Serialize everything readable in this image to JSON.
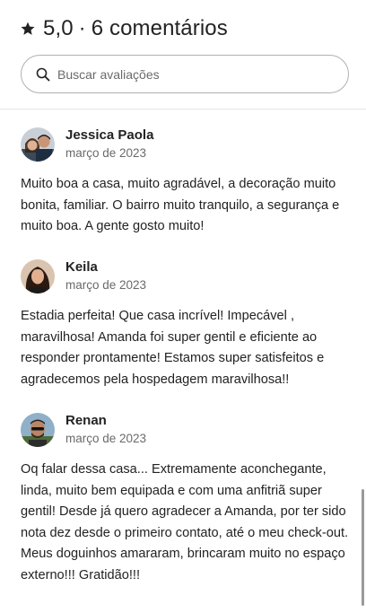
{
  "header": {
    "rating": "5,0",
    "separator": "·",
    "count_label": "6 comentários",
    "star_icon": "star-icon"
  },
  "search": {
    "placeholder": "Buscar avaliações",
    "icon": "search-icon"
  },
  "reviews": [
    {
      "name": "Jessica Paola",
      "date": "março de 2023",
      "text": "Muito boa a casa, muito agradável, a decoração muito bonita, familiar. O bairro muito tranquilo, a segurança e muito boa. A gente gosto muito!"
    },
    {
      "name": "Keila",
      "date": "março de 2023",
      "text": "Estadia perfeita! Que casa incrível! Impecável , maravilhosa! Amanda foi super gentil e eficiente ao responder prontamente! Estamos super satisfeitos e agradecemos pela hospedagem maravilhosa!!"
    },
    {
      "name": "Renan",
      "date": "março de 2023",
      "text": "Oq falar dessa casa... Extremamente aconchegante, linda, muito bem equipada e com uma anfitriã super gentil! Desde já quero agradecer a Amanda, por ter sido nota dez desde o primeiro contato, até o meu check-out.\nMeus doguinhos amararam, brincaram muito no espaço externo!!! Gratidão!!!"
    }
  ],
  "colors": {
    "text_primary": "#222222",
    "text_secondary": "#6a6a6a",
    "border": "#b0b0b0"
  }
}
